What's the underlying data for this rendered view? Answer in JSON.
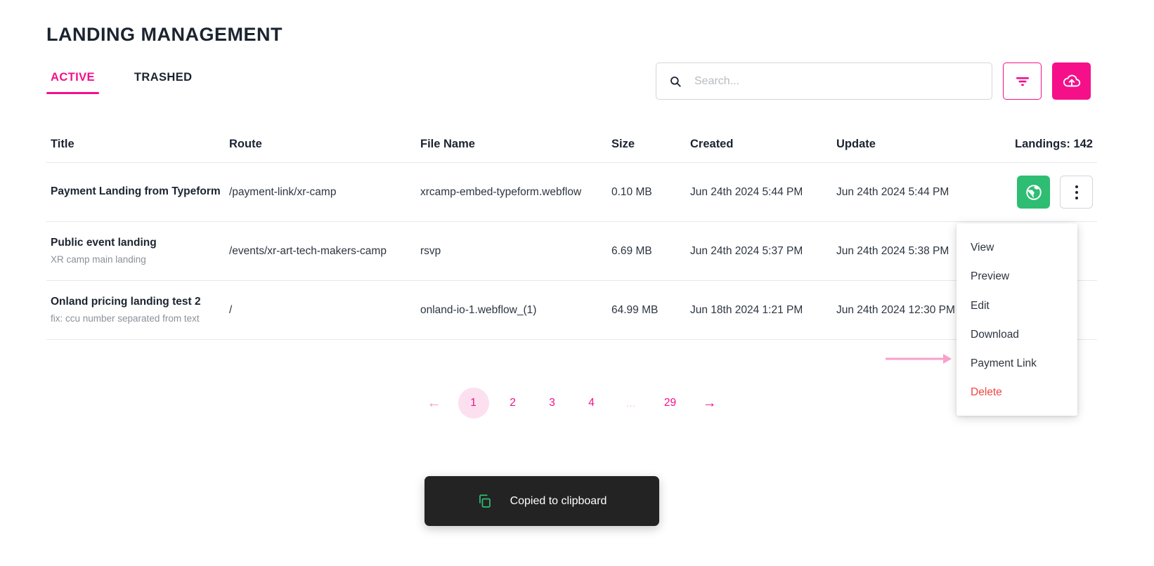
{
  "header": {
    "title": "LANDING MANAGEMENT",
    "tabs": [
      {
        "label": "ACTIVE",
        "active": true
      },
      {
        "label": "TRASHED",
        "active": false
      }
    ]
  },
  "search": {
    "placeholder": "Search...",
    "value": "",
    "icon": "search-icon"
  },
  "actions": {
    "filter_icon": "filter-icon",
    "upload_icon": "cloud-upload-icon"
  },
  "table": {
    "columns": [
      "Title",
      "Route",
      "File Name",
      "Size",
      "Created",
      "Update"
    ],
    "count_label": "Landings: 142",
    "rows": [
      {
        "title": "Payment Landing from Typeform",
        "subtitle": "",
        "route": "/payment-link/xr-camp",
        "file_name": "xrcamp-embed-typeform.webflow",
        "size": "0.10 MB",
        "created": "Jun 24th 2024 5:44 PM",
        "update": "Jun 24th 2024 5:44 PM"
      },
      {
        "title": "Public event landing",
        "subtitle": "XR camp main landing",
        "route": "/events/xr-art-tech-makers-camp",
        "file_name": "rsvp",
        "size": "6.69 MB",
        "created": "Jun 24th 2024 5:37 PM",
        "update": "Jun 24th 2024 5:38 PM"
      },
      {
        "title": "Onland pricing landing test 2",
        "subtitle": "fix: ccu number separated from text",
        "route": "/",
        "file_name": "onland-io-1.webflow_(1)",
        "size": "64.99 MB",
        "created": "Jun 18th 2024 1:21 PM",
        "update": "Jun 24th 2024 12:30 PM"
      }
    ]
  },
  "dropdown": {
    "items": [
      {
        "label": "View",
        "danger": false
      },
      {
        "label": "Preview",
        "danger": false
      },
      {
        "label": "Edit",
        "danger": false
      },
      {
        "label": "Download",
        "danger": false
      },
      {
        "label": "Payment Link",
        "danger": false
      },
      {
        "label": "Delete",
        "danger": true
      }
    ]
  },
  "pagination": {
    "prev": "←",
    "next": "→",
    "pages": [
      "1",
      "2",
      "3",
      "4",
      "…",
      "29"
    ],
    "current": "1"
  },
  "toast": {
    "message": "Copied to clipboard",
    "icon": "copy-icon"
  },
  "colors": {
    "accent_pink": "#f5108a",
    "accent_pink_light": "#fde0ef",
    "green": "#2ebd73",
    "danger_red": "#ef4444",
    "toast_bg": "#232323",
    "text_dark": "#1b2430",
    "text_muted": "#8b9198",
    "border": "#e6e8ea"
  }
}
